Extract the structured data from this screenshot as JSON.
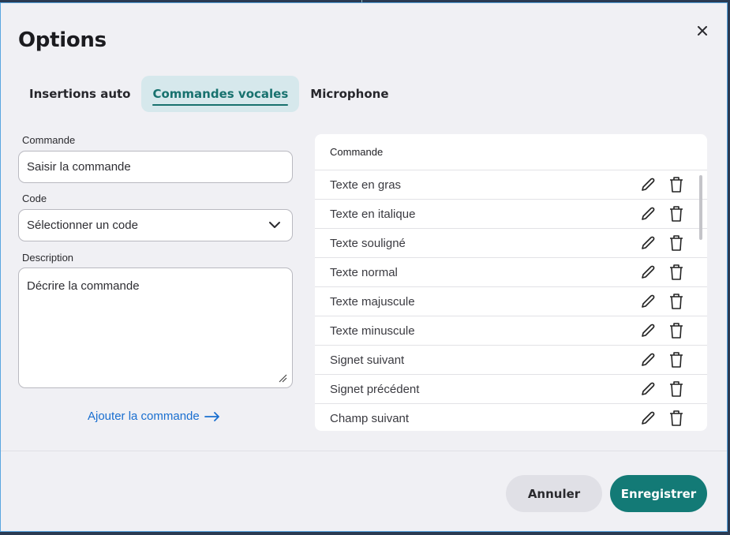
{
  "dialog": {
    "title": "Options",
    "close_icon": "close-icon"
  },
  "tabs": [
    {
      "label": "Insertions auto",
      "active": false
    },
    {
      "label": "Commandes vocales",
      "active": true
    },
    {
      "label": "Microphone",
      "active": false
    }
  ],
  "form": {
    "command_label": "Commande",
    "command_placeholder": "Saisir la commande",
    "code_label": "Code",
    "code_selected": "Sélectionner un code",
    "description_label": "Description",
    "description_placeholder": "Décrire la commande",
    "add_link": "Ajouter la commande"
  },
  "table": {
    "header": "Commande",
    "rows": [
      "Texte en gras",
      "Texte en italique",
      "Texte souligné",
      "Texte normal",
      "Texte majuscule",
      "Texte minuscule",
      "Signet suivant",
      "Signet précédent",
      "Champ suivant"
    ],
    "edit_icon": "pencil-icon",
    "delete_icon": "trash-icon"
  },
  "footer": {
    "cancel_label": "Annuler",
    "save_label": "Enregistrer"
  },
  "colors": {
    "accent": "#137a76",
    "link": "#1a6fd0",
    "active_tab_bg": "#d6e8ec"
  }
}
